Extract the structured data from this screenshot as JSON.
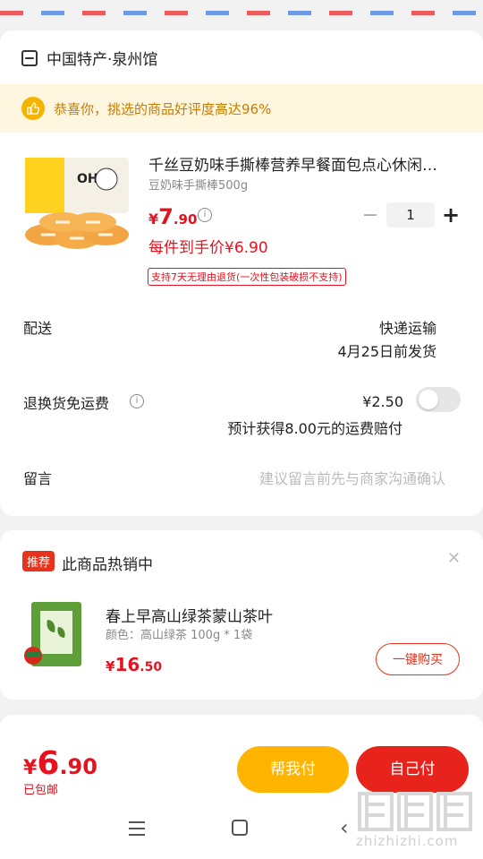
{
  "store": {
    "name": "中国特产·泉州馆",
    "icon": "store-icon"
  },
  "notice": {
    "text": "恭喜你，挑选的商品好评度高达96%",
    "icon": "thumb-up-icon"
  },
  "product": {
    "title": "千丝豆奶味手撕棒营养早餐面包点心休闲…",
    "spec": "豆奶味手撕棒500g",
    "price_symbol": "¥",
    "price_int": "7",
    "price_dec": ".90",
    "quantity": "1",
    "unit_price_text": "每件到手价¥6.90",
    "return_policy": "支持7天无理由退货(一次性包装破损不支持)"
  },
  "delivery": {
    "label": "配送",
    "method": "快递运输",
    "date": "4月25日前发货"
  },
  "return_shipping": {
    "label": "退换货免运费",
    "price": "¥2.50",
    "note": "预计获得8.00元的运费赔付"
  },
  "message": {
    "label": "留言",
    "placeholder": "建议留言前先与商家沟通确认"
  },
  "recommend": {
    "badge": "推荐",
    "title": "此商品热销中",
    "item_name": "春上早高山绿茶蒙山茶叶",
    "item_spec": "颜色：高山绿茶 100g * 1袋",
    "price_symbol": "¥",
    "price_int": "16",
    "price_dec": ".50",
    "buy_label": "一键购买"
  },
  "bottom": {
    "price_symbol": "¥",
    "price_int": "6",
    "price_dec": ".90",
    "shipping_text": "已包邮",
    "help_pay_label": "帮我付",
    "self_pay_label": "自己付"
  },
  "watermark": {
    "text": "zhizhizhi.com"
  },
  "colors": {
    "accent_red": "#e4131f",
    "accent_yellow": "#ffb400",
    "notice_bg": "#fff6e0"
  }
}
